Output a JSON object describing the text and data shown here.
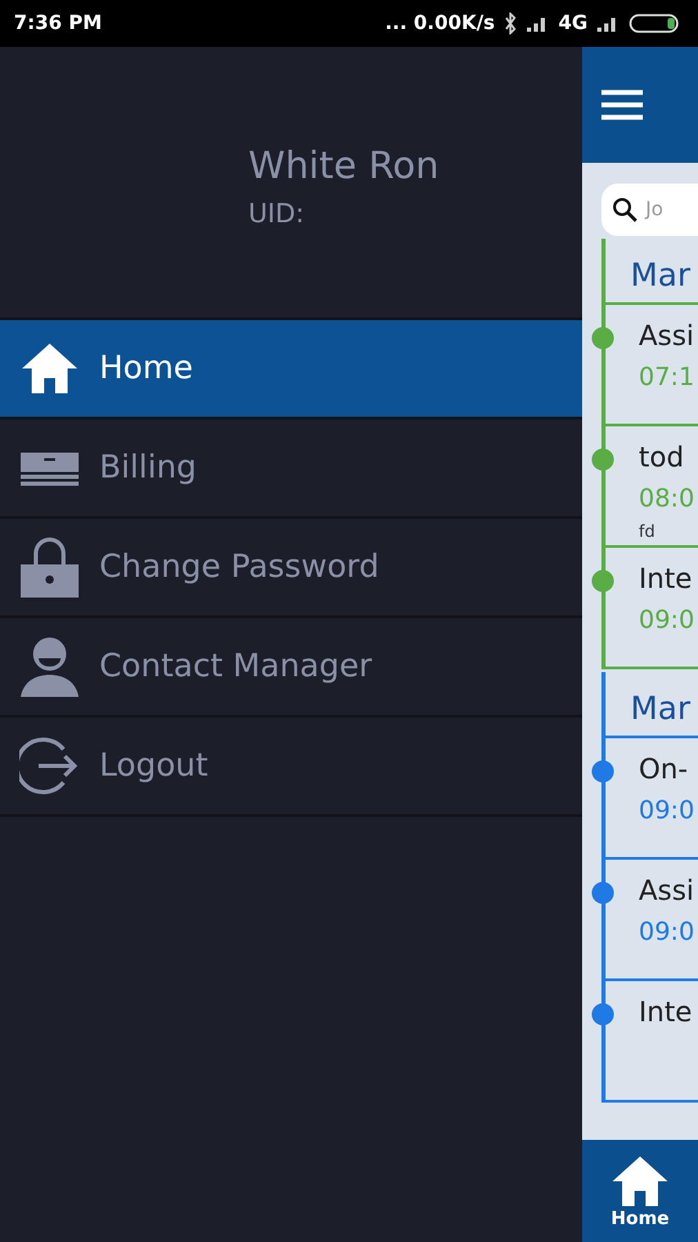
{
  "status_bar": {
    "time": "7:36 PM",
    "speed": "... 0.00K/s",
    "network": "4G"
  },
  "drawer": {
    "user_name": "White Ron",
    "uid_label": "UID:",
    "items": [
      {
        "label": "Home",
        "kind": "home",
        "selected": true
      },
      {
        "label": "Billing",
        "kind": "billing",
        "selected": false
      },
      {
        "label": "Change Password",
        "kind": "password",
        "selected": false
      },
      {
        "label": "Contact Manager",
        "kind": "contact",
        "selected": false
      },
      {
        "label": "Logout",
        "kind": "logout",
        "selected": false
      }
    ]
  },
  "main": {
    "search": {
      "placeholder": "Jo"
    },
    "groups": [
      {
        "date": "Mar",
        "color": "#5aac44",
        "entries": [
          {
            "title": "Assi",
            "time": "07:1"
          },
          {
            "title": "tod",
            "time": "08:0",
            "note": "fd"
          },
          {
            "title": "Inte",
            "time": "09:0"
          }
        ]
      },
      {
        "date": "Mar",
        "color": "#1f7ae6",
        "entries": [
          {
            "title": "On-",
            "time": "09:0"
          },
          {
            "title": "Assi",
            "time": "09:0"
          },
          {
            "title": "Inte"
          }
        ]
      }
    ],
    "bottom_nav": [
      {
        "label": "Home",
        "selected": true
      }
    ]
  }
}
